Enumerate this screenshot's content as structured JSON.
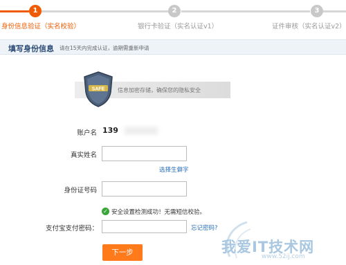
{
  "steps": [
    {
      "number": "1",
      "label": "身份信息验证（实名校验）",
      "status": "active"
    },
    {
      "number": "2",
      "label": "银行卡验证（实名认证v1）",
      "status": "inactive"
    },
    {
      "number": "3",
      "label": "证件审核（实名认证v2）",
      "status": "inactive"
    }
  ],
  "section": {
    "title": "填写身份信息",
    "note": "请在15天内完成认证，逾期需重新申请"
  },
  "privacy": {
    "badge": "SAFE",
    "text": "信息加密存储，确保您的隐私安全"
  },
  "form": {
    "account_label": "账户名",
    "account_value": "139",
    "real_name_label": "真实姓名",
    "real_name_value": "",
    "rare_char_link": "选择生僻字",
    "id_label": "身份证号码",
    "id_value": "",
    "security_ok": "安全设置检测成功！无需短信校验。",
    "pay_pwd_label": "支付宝支付密码：",
    "pay_pwd_value": "",
    "forgot_link": "忘记密码?",
    "next_button": "下一步"
  },
  "watermark": {
    "text": "我爱IT技术网",
    "url": "www.52ij.com"
  },
  "colors": {
    "accent": "#ef5b00",
    "inactive": "#c8c8c8",
    "link": "#2a6fba",
    "button": "#ff7a1a"
  }
}
